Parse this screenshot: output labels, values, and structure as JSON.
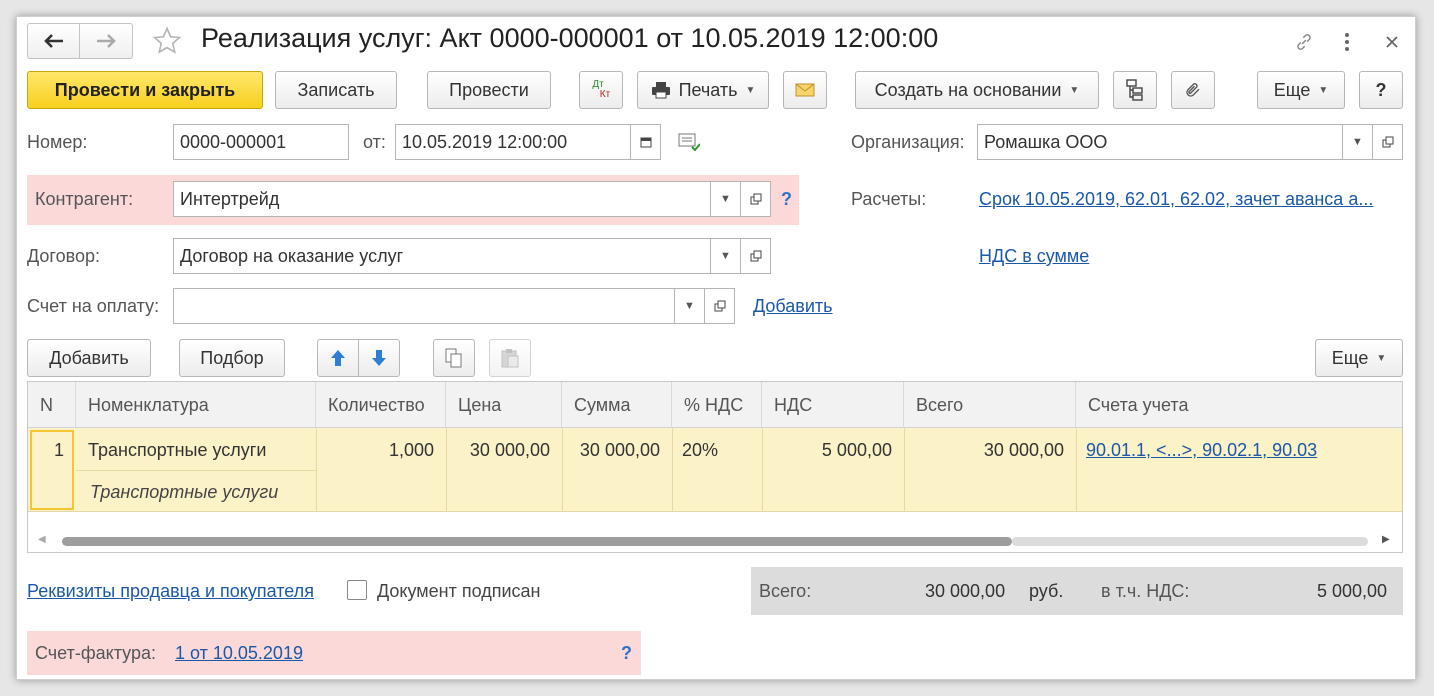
{
  "window": {
    "title": "Реализация услуг: Акт 0000-000001 от 10.05.2019 12:00:00"
  },
  "nav": {
    "back_icon": "arrow-left-icon",
    "forward_icon": "arrow-right-icon",
    "favorite_icon": "star-icon"
  },
  "window_controls": {
    "link_icon": "link-icon",
    "menu_icon": "more-vertical-icon",
    "close_icon": "close-icon"
  },
  "toolbar": {
    "post_close": "Провести и закрыть",
    "save": "Записать",
    "post": "Провести",
    "dt_top": "Дт",
    "dt_bottom": "Кт",
    "print": "Печать",
    "create_based": "Создать на основании",
    "more": "Еще",
    "help": "?"
  },
  "header": {
    "number_label": "Номер:",
    "number_value": "0000-000001",
    "date_label": "от:",
    "date_value": "10.05.2019 12:00:00",
    "org_label": "Организация:",
    "org_value": "Ромашка ООО",
    "counterparty_label": "Контрагент:",
    "counterparty_value": "Интертрейд",
    "help": "?",
    "settlements_label": "Расчеты:",
    "settlements_link": "Срок 10.05.2019, 62.01, 62.02, зачет аванса а...",
    "contract_label": "Договор:",
    "contract_value": "Договор на оказание услуг",
    "vat_link": "НДС в сумме",
    "invoice_label": "Счет на оплату:",
    "invoice_value": "",
    "invoice_add": "Добавить"
  },
  "table_toolbar": {
    "add": "Добавить",
    "pick": "Подбор",
    "more": "Еще"
  },
  "table": {
    "columns": [
      "N",
      "Номенклатура",
      "Количество",
      "Цена",
      "Сумма",
      "% НДС",
      "НДС",
      "Всего",
      "Счета учета"
    ],
    "rows": [
      {
        "n": "1",
        "item": "Транспортные услуги",
        "item_sub": "Транспортные услуги",
        "qty": "1,000",
        "price": "30 000,00",
        "sum": "30 000,00",
        "vat_rate": "20%",
        "vat": "5 000,00",
        "total": "30 000,00",
        "accounts": "90.01.1, <...>, 90.02.1, 90.03"
      }
    ]
  },
  "footer": {
    "requisites_link": "Реквизиты продавца и покупателя",
    "signed_label": "Документ подписан",
    "signed_checked": false,
    "total_label": "Всего:",
    "total_value": "30 000,00",
    "currency": "руб.",
    "vat_label": "в т.ч. НДС:",
    "vat_value": "5 000,00",
    "invoice_label": "Счет-фактура:",
    "invoice_link": "1 от 10.05.2019",
    "help": "?"
  },
  "colors": {
    "primary_button": "#f8d01e",
    "error_highlight": "#fbd9d9",
    "link": "#1b58a8",
    "selected_row": "#fbf2c8",
    "totals_bg": "#dcdcdc"
  }
}
